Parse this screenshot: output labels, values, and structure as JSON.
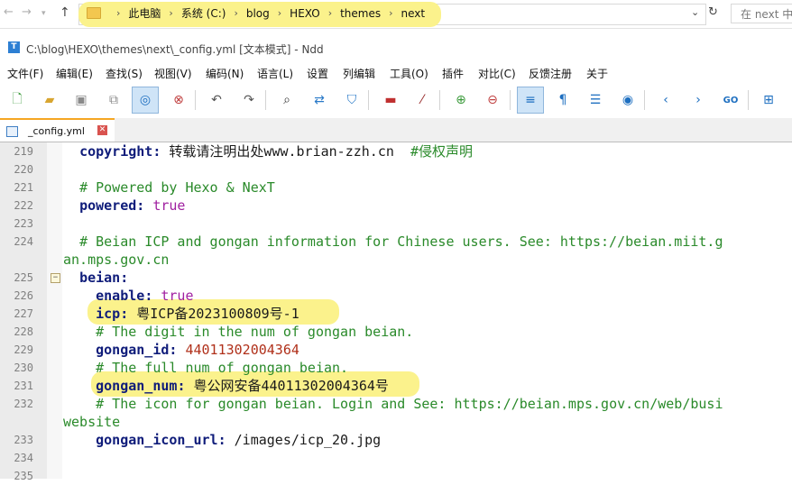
{
  "explorer": {
    "breadcrumbs": [
      "此电脑",
      "系统 (C:)",
      "blog",
      "HEXO",
      "themes",
      "next"
    ],
    "search_placeholder": "在 next 中"
  },
  "window": {
    "title": "C:\\blog\\HEXO\\themes\\next\\_config.yml [文本模式] - Ndd"
  },
  "menu": [
    "文件(F)",
    "编辑(E)",
    "查找(S)",
    "视图(V)",
    "编码(N)",
    "语言(L)",
    "设置",
    "列编辑",
    "工具(O)",
    "插件",
    "对比(C)",
    "反馈注册",
    "关于"
  ],
  "toolbar_icons": [
    "new-file-icon",
    "open-file-icon",
    "save-icon",
    "save-all-icon",
    "text-mode-icon",
    "close-file-icon",
    "undo-icon",
    "redo-icon",
    "find-icon",
    "replace-icon",
    "bookmark-icon",
    "marker-icon",
    "clear-marker-icon",
    "zoom-in-icon",
    "zoom-out-icon",
    "word-wrap-icon",
    "show-symbols-icon",
    "indent-guide-icon",
    "macro-icon",
    "prev-icon",
    "next-icon",
    "goto-icon",
    "split-view-icon"
  ],
  "tab": {
    "label": "_config.yml"
  },
  "editor": {
    "lines": [
      {
        "n": "219",
        "segs": [
          [
            "  ",
            "val"
          ],
          [
            "copyright",
            "key"
          ],
          [
            ": ",
            "key"
          ],
          [
            "转载请注明出处www.brian-zzh.cn  ",
            "val"
          ],
          [
            "#侵权声明",
            "cmt"
          ]
        ]
      },
      {
        "n": "220",
        "segs": []
      },
      {
        "n": "221",
        "segs": [
          [
            "  ",
            "val"
          ],
          [
            "# Powered by Hexo & NexT",
            "cmt"
          ]
        ]
      },
      {
        "n": "222",
        "segs": [
          [
            "  ",
            "val"
          ],
          [
            "powered",
            "key"
          ],
          [
            ": ",
            "key"
          ],
          [
            "true",
            "bool"
          ]
        ]
      },
      {
        "n": "223",
        "segs": []
      },
      {
        "n": "224",
        "segs": [
          [
            "  ",
            "val"
          ],
          [
            "# Beian ICP and gongan information for Chinese users. See: https://beian.miit.g",
            "cmt"
          ]
        ]
      },
      {
        "n": "",
        "segs": [
          [
            "an.mps.gov.cn",
            "cmt"
          ]
        ]
      },
      {
        "n": "225",
        "segs": [
          [
            "  ",
            "val"
          ],
          [
            "beian",
            "key"
          ],
          [
            ":",
            "key"
          ]
        ]
      },
      {
        "n": "226",
        "segs": [
          [
            "    ",
            "val"
          ],
          [
            "enable",
            "key"
          ],
          [
            ": ",
            "key"
          ],
          [
            "true",
            "bool"
          ]
        ]
      },
      {
        "n": "227",
        "segs": [
          [
            "    ",
            "val"
          ],
          [
            "icp",
            "key"
          ],
          [
            ": ",
            "key"
          ],
          [
            "粤ICP备2023100809号-1",
            "val"
          ]
        ]
      },
      {
        "n": "228",
        "segs": [
          [
            "    ",
            "val"
          ],
          [
            "# The digit in the num of gongan beian.",
            "cmt"
          ]
        ]
      },
      {
        "n": "229",
        "segs": [
          [
            "    ",
            "val"
          ],
          [
            "gongan_id",
            "key"
          ],
          [
            ": ",
            "key"
          ],
          [
            "44011302004364",
            "num"
          ]
        ]
      },
      {
        "n": "230",
        "segs": [
          [
            "    ",
            "val"
          ],
          [
            "# The full num of gongan beian.",
            "cmt"
          ]
        ]
      },
      {
        "n": "231",
        "segs": [
          [
            "    ",
            "val"
          ],
          [
            "gongan_num",
            "key"
          ],
          [
            ": ",
            "key"
          ],
          [
            "粤公网安备44011302004364号",
            "val"
          ]
        ]
      },
      {
        "n": "232",
        "segs": [
          [
            "    ",
            "val"
          ],
          [
            "# The icon for gongan beian. Login and See: https://beian.mps.gov.cn/web/busi",
            "cmt"
          ]
        ]
      },
      {
        "n": "",
        "segs": [
          [
            "website",
            "cmt"
          ]
        ]
      },
      {
        "n": "233",
        "segs": [
          [
            "    ",
            "val"
          ],
          [
            "gongan_icon_url",
            "key"
          ],
          [
            ": ",
            "key"
          ],
          [
            "/images/icp_20.jpg",
            "val"
          ]
        ]
      },
      {
        "n": "234",
        "segs": []
      },
      {
        "n": "235",
        "segs": []
      }
    ]
  },
  "highlight_color": "#fbf28c"
}
